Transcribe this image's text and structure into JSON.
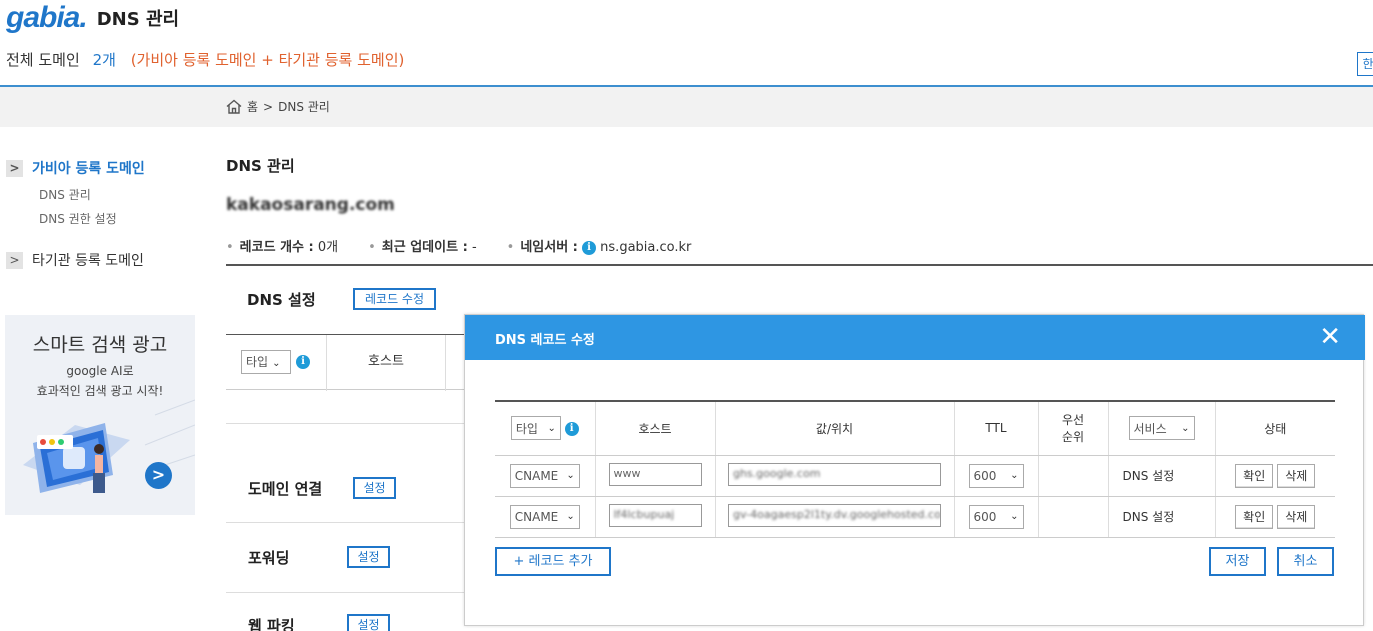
{
  "header": {
    "logo": "gabia",
    "logo_dot": ".",
    "app_title": "DNS 관리",
    "summary_label": "전체 도메인",
    "summary_count": "2개",
    "summary_hint": "(가비아 등록 도메인 + 타기관 등록 도메인)",
    "right_btn": "한"
  },
  "breadcrumb": {
    "home": "홈",
    "sep": ">",
    "current": "DNS 관리"
  },
  "sidebar": {
    "group1": {
      "arrow": ">",
      "label": "가비아 등록 도메인"
    },
    "sub_items": [
      "DNS 관리",
      "DNS 권한 설정"
    ],
    "group2": {
      "arrow": ">",
      "label": "타기관 등록 도메인"
    }
  },
  "ad": {
    "title": "스마트 검색 광고",
    "line1": "google AI로",
    "line2": "효과적인 검색 광고 시작!",
    "btn": ">"
  },
  "main": {
    "title": "DNS 관리",
    "domain": "kakaosarang.com",
    "meta": {
      "records_label": "레코드 개수 :",
      "records_value": "0개",
      "updated_label": "최근 업데이트 :",
      "updated_value": "-",
      "ns_label": "네임서버 :",
      "ns_value": "ns.gabia.co.kr"
    },
    "dns_section": "DNS 설정",
    "record_edit_btn": "레코드 수정",
    "bg_type": "타입",
    "bg_host": "호스트",
    "sections": [
      {
        "label": "도메인 연결",
        "btn": "설정"
      },
      {
        "label": "포워딩",
        "btn": "설정"
      },
      {
        "label": "웹 파킹",
        "btn": "설정"
      }
    ]
  },
  "modal": {
    "title": "DNS 레코드 수정",
    "close": "✕",
    "columns": {
      "type": "타입",
      "host": "호스트",
      "value": "값/위치",
      "ttl": "TTL",
      "priority_1": "우선",
      "priority_2": "순위",
      "service": "서비스",
      "status": "상태"
    },
    "rows": [
      {
        "type": "CNAME",
        "host": "www",
        "value": "ghs.google.com",
        "ttl": "600",
        "service": "DNS 설정",
        "confirm": "확인",
        "delete": "삭제"
      },
      {
        "type": "CNAME",
        "host": "lf4lcbupuaj",
        "value": "gv-4oagaesp2l1ty.dv.googlehosted.co",
        "ttl": "600",
        "service": "DNS 설정",
        "confirm": "확인",
        "delete": "삭제"
      }
    ],
    "add_btn": "+ 레코드 추가",
    "save_btn": "저장",
    "cancel_btn": "취소"
  },
  "colors": {
    "accent": "#1f76c9",
    "modal_header": "#2e96e3",
    "hint": "#e0622f"
  }
}
